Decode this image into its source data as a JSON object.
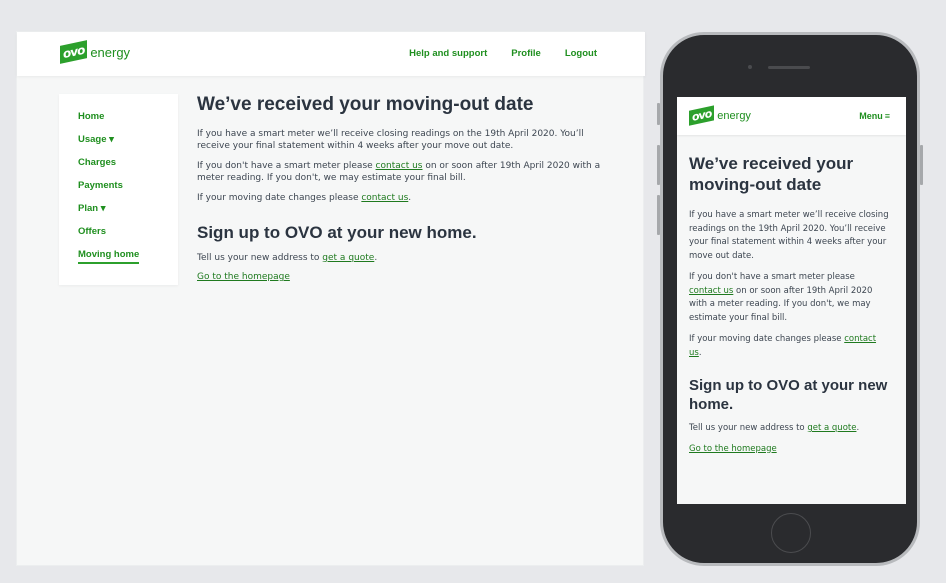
{
  "brand": {
    "mark": "ovo",
    "name": "energy",
    "color": "#2ca02c"
  },
  "desktop": {
    "nav": {
      "help": "Help and support",
      "profile": "Profile",
      "logout": "Logout"
    },
    "sidebar": {
      "items": [
        {
          "label": "Home"
        },
        {
          "label": "Usage ▾"
        },
        {
          "label": "Charges"
        },
        {
          "label": "Payments"
        },
        {
          "label": "Plan ▾"
        },
        {
          "label": "Offers"
        },
        {
          "label": "Moving home"
        }
      ]
    }
  },
  "content": {
    "title": "We’ve received your moving-out date",
    "p1": "If you have a smart meter we’ll receive closing readings on the 19th April 2020. You’ll receive your final statement within 4 weeks after your move out date.",
    "p2_before": "If you don't have a smart meter please ",
    "p2_link": "contact us",
    "p2_after": " on or soon after 19th April 2020 with a meter reading. If you don't, we may estimate your final bill.",
    "p3_before": "If your moving date changes please ",
    "p3_link": "contact us",
    "p3_after": ".",
    "subtitle": "Sign up to OVO at your new home.",
    "p4_before": "Tell us your new address to ",
    "p4_link": "get a quote",
    "p4_after": ".",
    "home_link": "Go to the homepage"
  },
  "mobile": {
    "menu_label": "Menu",
    "menu_icon": "≡"
  }
}
